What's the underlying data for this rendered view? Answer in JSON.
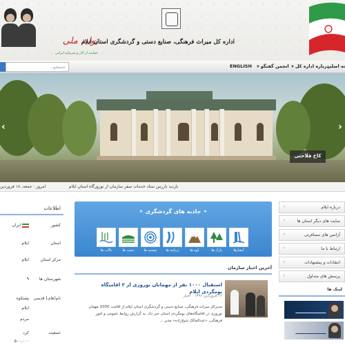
{
  "header": {
    "org_title": "اداره کل میراث فرهنگی، صنایع دستی و گردشگری استان ایلام",
    "slogan_part1": "تولید ملی",
    "slogan_part2": "حمایت از کار و سرمایه ایرانی",
    "colors": {
      "green": "#2e8b3a",
      "red": "#c0282d"
    }
  },
  "nav": {
    "items": [
      "صفحه اصلی",
      "درباره اداره کل",
      "انجمن گفتگو",
      "ENGLISH"
    ],
    "search_placeholder": "جستجو...",
    "accent": "#3a78c3"
  },
  "slider": {
    "caption": "کاخ فلاحتی",
    "prev_icon": "chevron-left-icon",
    "next_icon": "chevron-right-icon"
  },
  "ticker": {
    "date": "امروز : جمعه, ۱۸ فروردین",
    "news": "بازدید بازرس ستاد خدمات سفر سازمان از نوروزگاه استان ایلام"
  },
  "left_panel": {
    "title": "اطلاعات",
    "rows": [
      {
        "k": "کشور",
        "v": "ایران"
      },
      {
        "k": "استان",
        "v": "ایلام"
      },
      {
        "k": "مرکز استان",
        "v": "ایلام"
      },
      {
        "k": "شهرستان ها",
        "v": "۹"
      },
      {
        "k": "نام(های) قدیمی",
        "v": "پشتکوه"
      },
      {
        "k": "",
        "v": "ایلام"
      },
      {
        "k": "",
        "v": "مردم"
      },
      {
        "k": "جمعیت",
        "v": "کرد"
      },
      {
        "k": "",
        "v": "۵۰۰,۰۰۰"
      }
    ]
  },
  "tourism": {
    "title": "جاذبه های گردشگری",
    "icons": [
      {
        "icon": "waterfall-icon",
        "label": "آبشارها"
      },
      {
        "icon": "forest-icon",
        "label": "پارک ها"
      },
      {
        "icon": "mountain-icon",
        "label": "کوه ها"
      },
      {
        "icon": "river-icon",
        "label": "دریاچه ها"
      },
      {
        "icon": "spring-icon",
        "label": "چشمه ها"
      },
      {
        "icon": "plains-icon",
        "label": "دشت ها"
      },
      {
        "icon": "wetland-icon",
        "label": "تالاب ها"
      }
    ]
  },
  "news": {
    "heading": "آخرین اخبار سازمان",
    "title": "استقبال ۱۰۰۰ نفر از مهمانان نوروزی از ۲ اقامتگاه بومگردی ایلام",
    "date": "۱۶ فروردین ۱۳۹۶",
    "category": "اخبار",
    "body": "مدیرکل میراث فرهنگی، صنایع دستی و گردشگری استان ایلام از اقامت 1000 مهمان نوروزی در اقامتگاه‌های بومگردی استان خبر داد. به گزارش روابط عمومی و امور فرهنگی، «عبدالمالک شیخ‌زاده» مدیر ..."
  },
  "right_panel": {
    "items": [
      "درباره ایلام",
      "سایت های دیگر استان ها",
      "آژانس های مسافرتی",
      "ارتباط با ما",
      "انتقادات و پیشنهادات",
      "پرسش های متداول"
    ],
    "links_heading": "لینک ها"
  }
}
